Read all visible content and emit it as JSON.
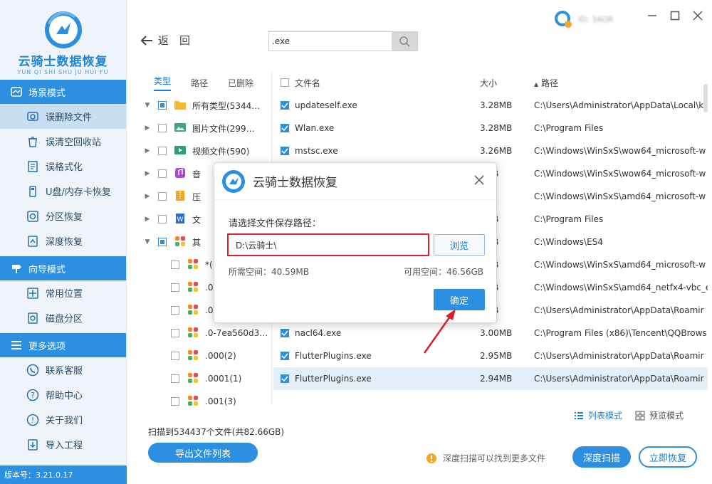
{
  "app": {
    "title": "云骑士数据恢复",
    "subtitle": "YUN QI SHI SHU JU HUI FU",
    "version": "版本号：3.21.0.17",
    "account_name": "ID: 3AQR"
  },
  "sidebar": {
    "sections": [
      {
        "label": "场景模式",
        "items": [
          "误删除文件",
          "误清空回收站",
          "误格式化",
          "U盘/内存卡恢复",
          "分区恢复",
          "深度恢复"
        ]
      },
      {
        "label": "向导模式",
        "items": [
          "常用位置",
          "磁盘分区"
        ]
      },
      {
        "label": "更多选项",
        "items": [
          "联系客服",
          "帮助中心",
          "关于我们",
          "导入工程"
        ]
      }
    ]
  },
  "toolbar": {
    "back_label": "返　回",
    "search_value": ".exe"
  },
  "tree": {
    "tabs": [
      "类型",
      "路径",
      "已删除"
    ],
    "rows": [
      {
        "label": "所有类型(5344…",
        "caret": "▼",
        "check": "part"
      },
      {
        "label": "图片文件(299…",
        "caret": "▶",
        "check": "off"
      },
      {
        "label": "视频文件(590)",
        "caret": "▶",
        "check": "off"
      },
      {
        "label": "音",
        "caret": "▶",
        "check": "off"
      },
      {
        "label": "压",
        "caret": "▶",
        "check": "off"
      },
      {
        "label": "文",
        "caret": "▶",
        "check": "off"
      },
      {
        "label": "其",
        "caret": "▼",
        "check": "part"
      },
      {
        "label": "*(1",
        "caret": "",
        "check": "off"
      },
      {
        "label": ".00",
        "caret": "",
        "check": "off"
      },
      {
        "label": ".0",
        "caret": "",
        "check": "off"
      },
      {
        "label": ".0-7ea560d3…",
        "caret": "",
        "check": "off"
      },
      {
        "label": ".000(2)",
        "caret": "",
        "check": "off"
      },
      {
        "label": ".0001(1)",
        "caret": "",
        "check": "off"
      },
      {
        "label": ".001(3)",
        "caret": "",
        "check": "off"
      }
    ]
  },
  "list": {
    "headers": {
      "name": "文件名",
      "size": "大小",
      "path": "路径"
    },
    "rows": [
      {
        "name": "updateself.exe",
        "size": "3.28MB",
        "path": "C:\\Users\\Administrator\\AppData\\Local\\k"
      },
      {
        "name": "Wlan.exe",
        "size": "3.28MB",
        "path": "C:\\Program Files"
      },
      {
        "name": "mstsc.exe",
        "size": "3.26MB",
        "path": "C:\\Windows\\WinSxS\\wow64_microsoft-w"
      },
      {
        "name": "",
        "size": "5MB",
        "path": "C:\\Windows\\WinSxS\\wow64_microsoft-w"
      },
      {
        "name": "",
        "size": "",
        "path": "C:\\Windows\\WinSxS\\amd64_microsoft-w"
      },
      {
        "name": "",
        "size": "2MB",
        "path": "C:\\Program Files"
      },
      {
        "name": "",
        "size": "1MB",
        "path": "C:\\Windows\\ES4"
      },
      {
        "name": "",
        "size": "3MB",
        "path": "C:\\Windows\\WinSxS\\amd64_microsoft-w"
      },
      {
        "name": "",
        "size": "3MB",
        "path": "C:\\Windows\\WinSxS\\amd64_netfx4-vbc_e"
      },
      {
        "name": "",
        "size": "0MB",
        "path": "C:\\Users\\Administrator\\AppData\\Roamir"
      },
      {
        "name": "nacl64.exe",
        "size": "3.00MB",
        "path": "C:\\Program Files (x86)\\Tencent\\QQBrows"
      },
      {
        "name": "FlutterPlugins.exe",
        "size": "2.95MB",
        "path": "C:\\Users\\Administrator\\AppData\\Roamir"
      },
      {
        "name": "FlutterPlugins.exe",
        "size": "2.94MB",
        "path": "C:\\Users\\Administrator\\AppData\\Roamir",
        "selected": true
      }
    ]
  },
  "bottom": {
    "list_mode": "列表模式",
    "preview_mode": "预览模式",
    "scan_info": "扫描到534437个文件(共82.66GB)",
    "export_label": "导出文件列表",
    "tip": "深度扫描可以找到更多文件",
    "deep_scan_label": "深度扫描",
    "recover_label": "立即恢复"
  },
  "dialog": {
    "title": "云骑士数据恢复",
    "prompt": "请选择文件保存路径：",
    "path_value": "D:\\云骑士\\",
    "browse_label": "浏览",
    "space_needed": "所需空间：40.59MB",
    "space_free": "可用空间：46.56GB",
    "ok_label": "确定"
  },
  "colors": {
    "accent": "#2c8fdf",
    "highlight_border": "#d81e26",
    "sidebar_bg": "#eef4fa"
  }
}
